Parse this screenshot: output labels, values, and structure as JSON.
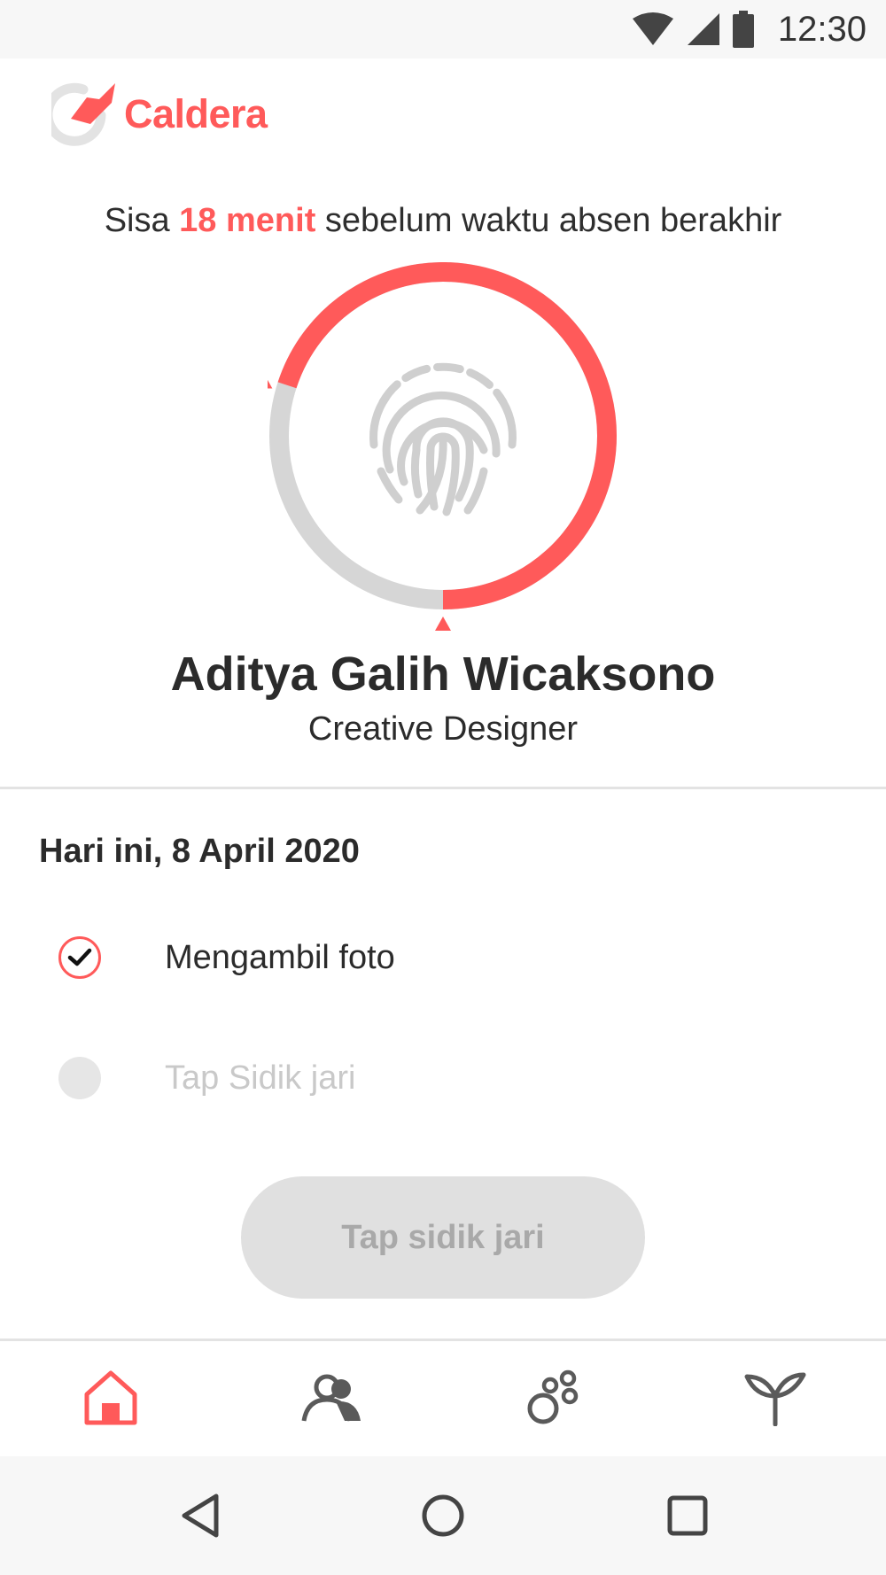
{
  "status_bar": {
    "time": "12:30",
    "icons": [
      "wifi-icon",
      "signal-icon",
      "battery-icon"
    ]
  },
  "app": {
    "logo_text": "Caldera",
    "brand_color": "#ff5a5a"
  },
  "countdown": {
    "prefix": "Sisa ",
    "highlight": "18 menit",
    "suffix": " sebelum waktu absen berakhir",
    "progress_fraction": 0.7
  },
  "fingerprint_icon": "fingerprint-icon",
  "user": {
    "name": "Aditya Galih Wicaksono",
    "role": "Creative Designer"
  },
  "today": {
    "title": "Hari ini, 8 April 2020",
    "steps": [
      {
        "label": "Mengambil foto",
        "status": "done"
      },
      {
        "label": "Tap Sidik jari",
        "status": "pending"
      }
    ]
  },
  "cta": {
    "label": "Tap sidik jari",
    "disabled": true
  },
  "bottom_nav": [
    {
      "icon": "home-icon",
      "active": true
    },
    {
      "icon": "people-icon",
      "active": false
    },
    {
      "icon": "bubbles-icon",
      "active": false
    },
    {
      "icon": "sprout-icon",
      "active": false
    }
  ],
  "system_nav": [
    "back-icon",
    "home-circle-icon",
    "recents-icon"
  ]
}
